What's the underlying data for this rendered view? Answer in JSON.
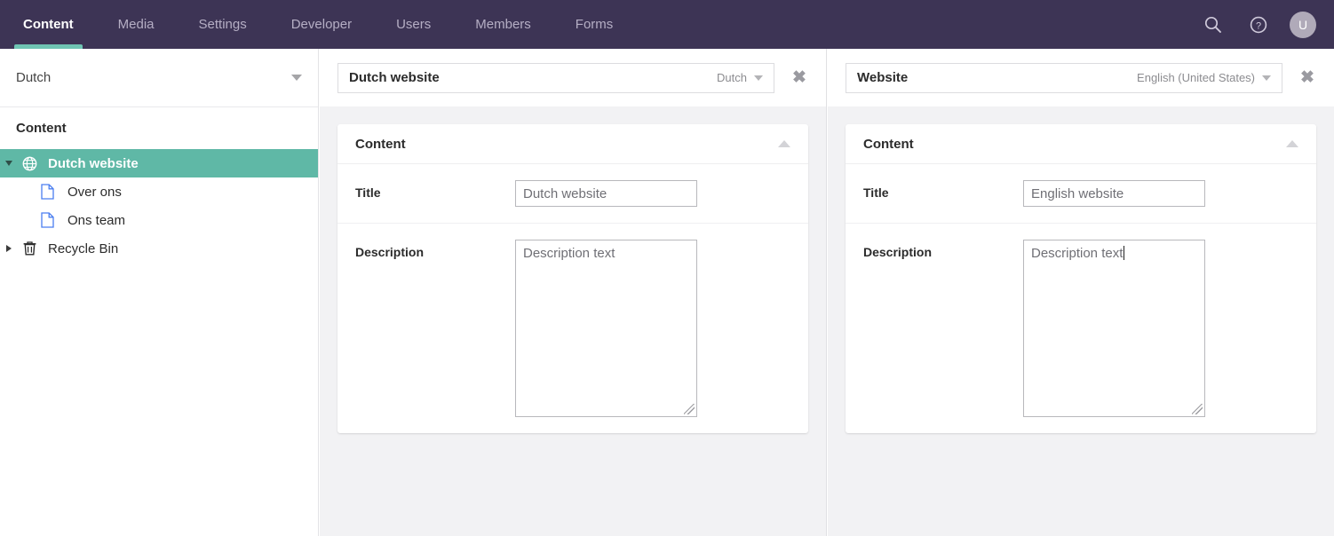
{
  "nav": {
    "tabs": [
      {
        "label": "Content",
        "active": true
      },
      {
        "label": "Media",
        "active": false
      },
      {
        "label": "Settings",
        "active": false
      },
      {
        "label": "Developer",
        "active": false
      },
      {
        "label": "Users",
        "active": false
      },
      {
        "label": "Members",
        "active": false
      },
      {
        "label": "Forms",
        "active": false
      }
    ],
    "icons": {
      "search": "search-icon",
      "help": "help-circle-icon",
      "avatar_initial": "U"
    },
    "colors": {
      "bar_background": "#3d3455",
      "active_underline": "#6fc4b3",
      "active_text": "#ffffff",
      "inactive_text": "#b5aec4"
    }
  },
  "sidebar": {
    "language_selector": {
      "value": "Dutch"
    },
    "section_title": "Content",
    "tree": [
      {
        "label": "Dutch website",
        "icon": "globe-icon",
        "expander": "down",
        "selected": true,
        "level": 0
      },
      {
        "label": "Over ons",
        "icon": "document-icon",
        "expander": "none",
        "selected": false,
        "level": 1
      },
      {
        "label": "Ons team",
        "icon": "document-icon",
        "expander": "none",
        "selected": false,
        "level": 1
      },
      {
        "label": "Recycle Bin",
        "icon": "trash-icon",
        "expander": "right",
        "selected": false,
        "level": 0
      }
    ],
    "colors": {
      "selected_row": "#5fb8a6",
      "document_icon": "#4a7ef0"
    }
  },
  "panels": [
    {
      "header": {
        "document_name": "Dutch website",
        "language": "Dutch",
        "close_label": "✖"
      },
      "card": {
        "title": "Content",
        "collapse_icon": "chevron-up-icon",
        "properties": [
          {
            "label": "Title",
            "type": "text",
            "value": "Dutch website"
          },
          {
            "label": "Description",
            "type": "textarea",
            "value": "Description text",
            "focused": false
          }
        ]
      }
    },
    {
      "header": {
        "document_name": "Website",
        "language": "English (United States)",
        "close_label": "✖"
      },
      "card": {
        "title": "Content",
        "collapse_icon": "chevron-up-icon",
        "properties": [
          {
            "label": "Title",
            "type": "text",
            "value": "English website"
          },
          {
            "label": "Description",
            "type": "textarea",
            "value": "Description text",
            "focused": true
          }
        ]
      }
    }
  ]
}
